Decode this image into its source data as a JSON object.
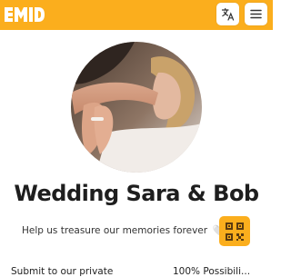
{
  "header": {
    "logo_text": "EMID",
    "translate_icon": "translate-icon",
    "menu_icon": "hamburger-menu-icon",
    "accent_color": "#fbae1d"
  },
  "main": {
    "photo_icon": "couple-photo",
    "title": "Wedding Sara & Bob",
    "subtitle": "Help us treasure our memories forever",
    "heart_glyph": "🤍",
    "qr_icon": "qr-code-icon"
  },
  "footer": {
    "left_text": "Submit to our private",
    "right_text": "100% Possibili..."
  }
}
